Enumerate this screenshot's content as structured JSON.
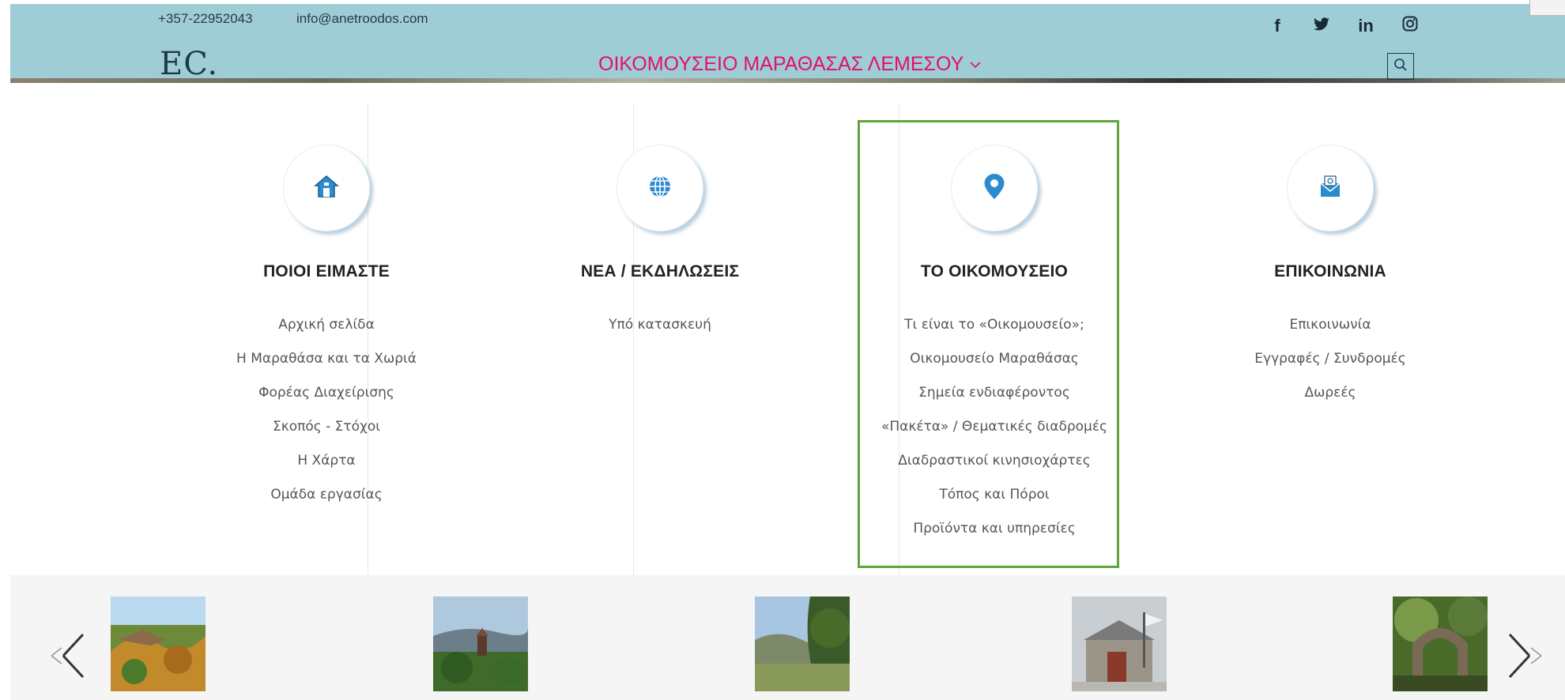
{
  "header": {
    "phone": "+357-22952043",
    "email": "info@anetroodos.com",
    "logo": "EC.",
    "nav_title": "ΟΙΚΟΜΟΥΣΕΙΟ ΜΑΡΑΘΑΣΑΣ ΛΕΜΕΣΟΥ",
    "socials": [
      "f",
      "twitter-icon",
      "in",
      "instagram-icon"
    ]
  },
  "colors": {
    "header_bg": "#9fcdd6",
    "accent_pink": "#e2106e",
    "icon_blue": "#1e88d0",
    "highlight_green": "#5ea53a"
  },
  "columns": [
    {
      "icon": "home-icon",
      "title": "ΠΟΙΟΙ ΕΙΜΑΣΤΕ",
      "links": [
        "Αρχική σελίδα",
        "Η Μαραθάσα και τα Χωριά",
        "Φορέας Διαχείρισης",
        "Σκοπός - Στόχοι",
        "Η Χάρτα",
        "Ομάδα εργασίας"
      ]
    },
    {
      "icon": "globe-icon",
      "title": "ΝΕΑ / ΕΚΔΗΛΩΣΕΙΣ",
      "links": [
        "Υπό κατασκευή"
      ]
    },
    {
      "icon": "location-pin-icon",
      "title": "ΤΟ ΟΙΚΟΜΟΥΣΕΙΟ",
      "links": [
        "Τι είναι το «Οικομουσείο»;",
        "Οικομουσείο Μαραθάσας",
        "Σημεία ενδιαφέροντος",
        "«Πακέτα» / Θεματικές διαδρομές",
        "Διαδραστικοί κινησιοχάρτες",
        "Τόπος και Πόροι",
        "Προϊόντα και υπηρεσίες"
      ]
    },
    {
      "icon": "mail-icon",
      "title": "ΕΠΙΚΟΙΝΩΝΙΑ",
      "links": [
        "Επικοινωνία",
        "Εγγραφές / Συνδρομές",
        "Δωρεές"
      ]
    }
  ],
  "carousel": {
    "prev_label": "<",
    "next_label": ">"
  }
}
